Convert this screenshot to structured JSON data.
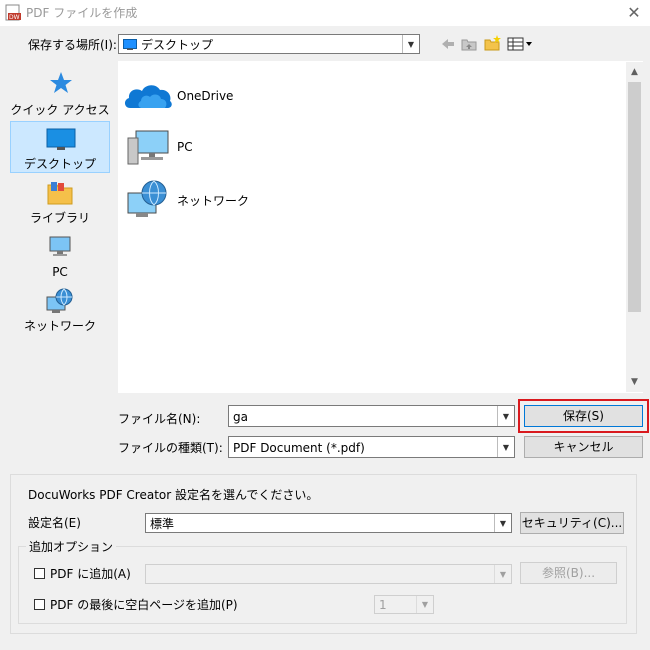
{
  "window": {
    "title": "PDF ファイルを作成",
    "close_glyph": "✕"
  },
  "location": {
    "label": "保存する場所(I):",
    "value": "デスクトップ"
  },
  "sidebar": {
    "items": [
      {
        "label": "クイック アクセス",
        "icon": "star-icon"
      },
      {
        "label": "デスクトップ",
        "icon": "desktop-icon"
      },
      {
        "label": "ライブラリ",
        "icon": "library-folder-icon"
      },
      {
        "label": "PC",
        "icon": "pc-icon"
      },
      {
        "label": "ネットワーク",
        "icon": "network-icon"
      }
    ]
  },
  "files": [
    {
      "label": "OneDrive",
      "icon": "onedrive-cloud-icon"
    },
    {
      "label": "PC",
      "icon": "pc-icon"
    },
    {
      "label": "ネットワーク",
      "icon": "network-icon"
    }
  ],
  "filename": {
    "label": "ファイル名(N):",
    "value": "ga"
  },
  "filetype": {
    "label": "ファイルの種類(T):",
    "value": "PDF Document (*.pdf)"
  },
  "buttons": {
    "save": "保存(S)",
    "cancel": "キャンセル",
    "security": "セキュリティ(C)...",
    "browse": "参照(B)..."
  },
  "creator": {
    "instruction": "DocuWorks PDF Creator 設定名を選んでください。",
    "setting_label": "設定名(E)",
    "setting_value": "標準"
  },
  "options": {
    "group_label": "追加オプション",
    "append_label": "PDF に追加(A)",
    "blank_page_label": "PDF の最後に空白ページを追加(P)",
    "page_count": "1"
  },
  "colors": {
    "highlight": "#d9191e",
    "selection": "#cce8ff",
    "accent": "#0078d7"
  }
}
